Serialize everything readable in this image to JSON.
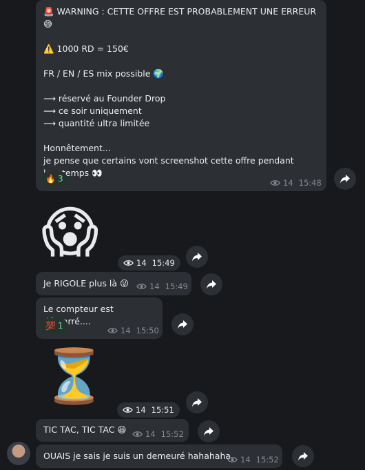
{
  "messages": {
    "m1": {
      "text": "🚨 WARNING : CETTE OFFRE EST PROBABLEMENT UNE ERREUR 😅\n\n⚠️ 1000 RD = 150€\n\nFR / EN / ES mix possible 🌍\n\n⟶ réservé au Founder Drop\n⟶ ce soir uniquement\n⟶ quantité ultra limitée\n\nHonnêtement...\nje pense que certains vont screenshot cette offre pendant longtemps 👀",
      "reaction_emoji": "🔥",
      "reaction_count": "3",
      "views": "14",
      "time": "15:48"
    },
    "m2": {
      "emoji": "😱",
      "views": "14",
      "time": "15:49"
    },
    "m3": {
      "text": "Je RIGOLE plus là 😜",
      "views": "14",
      "time": "15:49"
    },
    "m4": {
      "text": "Le compteur est démarré....",
      "reaction_emoji": "💯",
      "reaction_count": "1",
      "views": "14",
      "time": "15:50"
    },
    "m5": {
      "emoji": "⏳",
      "views": "14",
      "time": "15:51"
    },
    "m6": {
      "text": "TIC TAC, TIC TAC 😆",
      "views": "14",
      "time": "15:52"
    },
    "m7": {
      "text": "OUAIS je sais je suis un demeuré hahahaha",
      "views": "14",
      "time": "15:52"
    }
  },
  "icons": {
    "views": "eye-icon",
    "forward": "forward-arrow-icon"
  },
  "colors": {
    "background": "#17191d",
    "bubble": "#2c2f34",
    "meta_text": "#858990",
    "reaction_text": "#7ed3a4"
  }
}
